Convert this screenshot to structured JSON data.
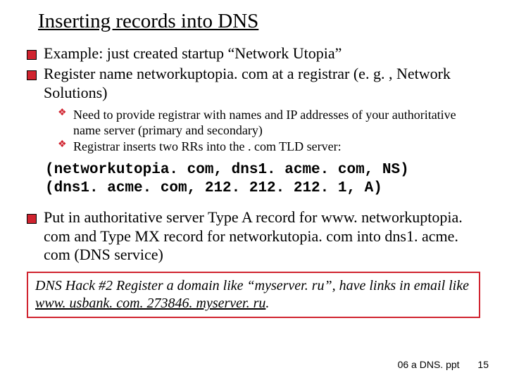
{
  "title": "Inserting records into DNS",
  "bullets_top_1": [
    "Example: just created startup “Network Utopia”",
    "Register name networkuptopia. com at a registrar (e. g. , Network Solutions)"
  ],
  "sub_bullets": [
    "Need to provide registrar with names and IP addresses of your authoritative name server (primary and secondary)",
    "Registrar inserts two RRs into the . com TLD server:"
  ],
  "code_lines": {
    "l1": "(networkutopia. com, dns1. acme. com, NS)",
    "l2": "(dns1. acme. com, 212. 212. 212. 1, A)"
  },
  "bullet_after": "Put in authoritative server Type A record for www. networkuptopia. com and Type MX record for networkutopia. com into dns1. acme. com (DNS service)",
  "hack": {
    "prefix": "DNS Hack #2  Register a domain like “myserver. ru”, have links in email like ",
    "link": "www. usbank. com. 273846. myserver. ru",
    "suffix": "."
  },
  "footer": {
    "file": "06 a DNS. ppt",
    "page": "15"
  }
}
